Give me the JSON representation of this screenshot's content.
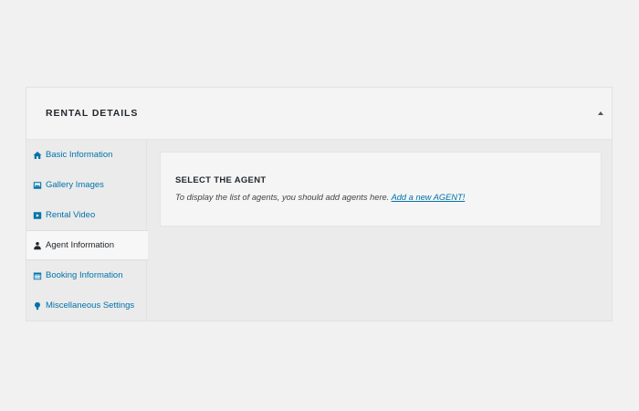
{
  "panel": {
    "title": "RENTAL DETAILS"
  },
  "tabs": [
    {
      "label": "Basic Information",
      "icon": "home-icon",
      "active": false
    },
    {
      "label": "Gallery Images",
      "icon": "images-icon",
      "active": false
    },
    {
      "label": "Rental Video",
      "icon": "video-icon",
      "active": false
    },
    {
      "label": "Agent Information",
      "icon": "agent-icon",
      "active": true
    },
    {
      "label": "Booking Information",
      "icon": "calendar-icon",
      "active": false
    },
    {
      "label": "Miscellaneous Settings",
      "icon": "lightbulb-icon",
      "active": false
    }
  ],
  "content": {
    "title": "SELECT THE AGENT",
    "text": "To display the list of agents, you should add agents here.",
    "link_label": "Add a new AGENT!"
  },
  "colors": {
    "link": "#0073aa",
    "text_dark": "#23282d",
    "background": "#f1f1f1"
  }
}
